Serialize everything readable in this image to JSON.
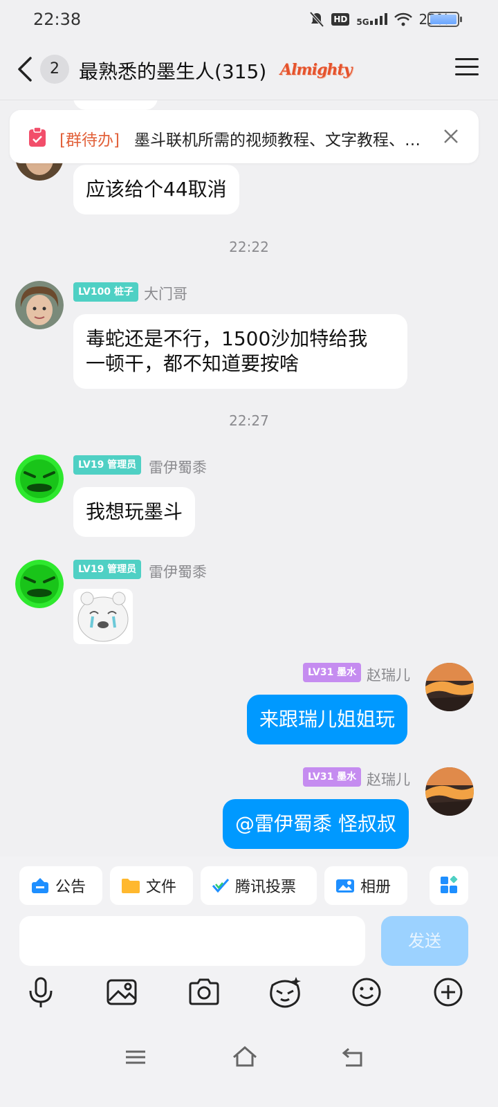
{
  "status_bar": {
    "time": "22:38",
    "hd": "HD",
    "network": "5G",
    "battery_percent": "23%",
    "battery_level": 0.23
  },
  "header": {
    "unread_count": "2",
    "title": "最熟悉的墨生人(315)",
    "logo_text": "Almighty"
  },
  "notice": {
    "tag": "[群待办]",
    "text": "墨斗联机所需的视频教程、文字教程、…"
  },
  "messages": [
    {
      "type": "text",
      "text": "应该给个44取消"
    },
    {
      "type": "time",
      "text": "22:22"
    },
    {
      "type": "text",
      "level": "LV100 桩子",
      "sender": "大门哥",
      "lines": [
        "毒蛇还是不行，1500沙加特给我",
        "一顿干，都不知道要按啥"
      ]
    },
    {
      "type": "time",
      "text": "22:27"
    },
    {
      "type": "text",
      "level": "LV19 管理员",
      "sender": "雷伊蜀黍",
      "text": "我想玩墨斗"
    },
    {
      "type": "sticker",
      "level": "LV19 管理员",
      "sender": "雷伊蜀黍"
    },
    {
      "type": "text",
      "mine": true,
      "level": "LV31 墨水",
      "sender": "赵瑞儿",
      "text": "来跟瑞儿姐姐玩"
    },
    {
      "type": "text",
      "mine": true,
      "level": "LV31 墨水",
      "sender": "赵瑞儿",
      "text": "@雷伊蜀黍 怪叔叔"
    }
  ],
  "quick_actions": [
    "公告",
    "文件",
    "腾讯投票",
    "相册"
  ],
  "input": {
    "placeholder": "",
    "send_label": "发送"
  },
  "colors": {
    "accent": "#0099ff",
    "send_disabled": "#9cd2ff",
    "level_teal": "#4fd0c4",
    "level_purple": "#c58cf0",
    "notice_tag": "#e2623b"
  }
}
